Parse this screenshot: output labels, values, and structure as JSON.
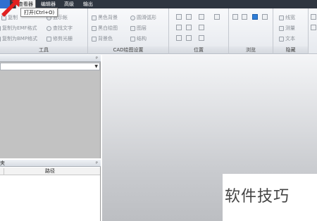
{
  "menubar": {
    "tabs": [
      "查看器",
      "编辑器",
      "高级",
      "输出"
    ],
    "active_tab": "查看器"
  },
  "tooltip": {
    "text": "打开(Ctrl+O)"
  },
  "ribbon": {
    "tools": {
      "title": "工具",
      "items": [
        "复制",
        "显示帐",
        "复制为EMF格式",
        "查找文字",
        "复制为BMP格式",
        "修剪光栅"
      ]
    },
    "cad_settings": {
      "title": "CAD绘图设置",
      "items": [
        "黑色背景",
        "圆滑弧形",
        "黑白绘图",
        "图层",
        "背景色",
        "结构"
      ]
    },
    "position": {
      "title": "位置"
    },
    "browse": {
      "title": "浏览"
    },
    "hide": {
      "title": "隐藏",
      "items": [
        "线宽",
        "测量",
        "文本"
      ]
    }
  },
  "panels": {
    "top": {
      "pin": "ᵖ"
    },
    "bottom": {
      "title": "夹",
      "pin": "ᵖ",
      "column_header": "路径"
    }
  },
  "watermark": {
    "text": "软件技巧"
  },
  "colors": {
    "menubar": "#2f3640",
    "accent": "#2f6fcf",
    "arrow": "#e02020"
  }
}
